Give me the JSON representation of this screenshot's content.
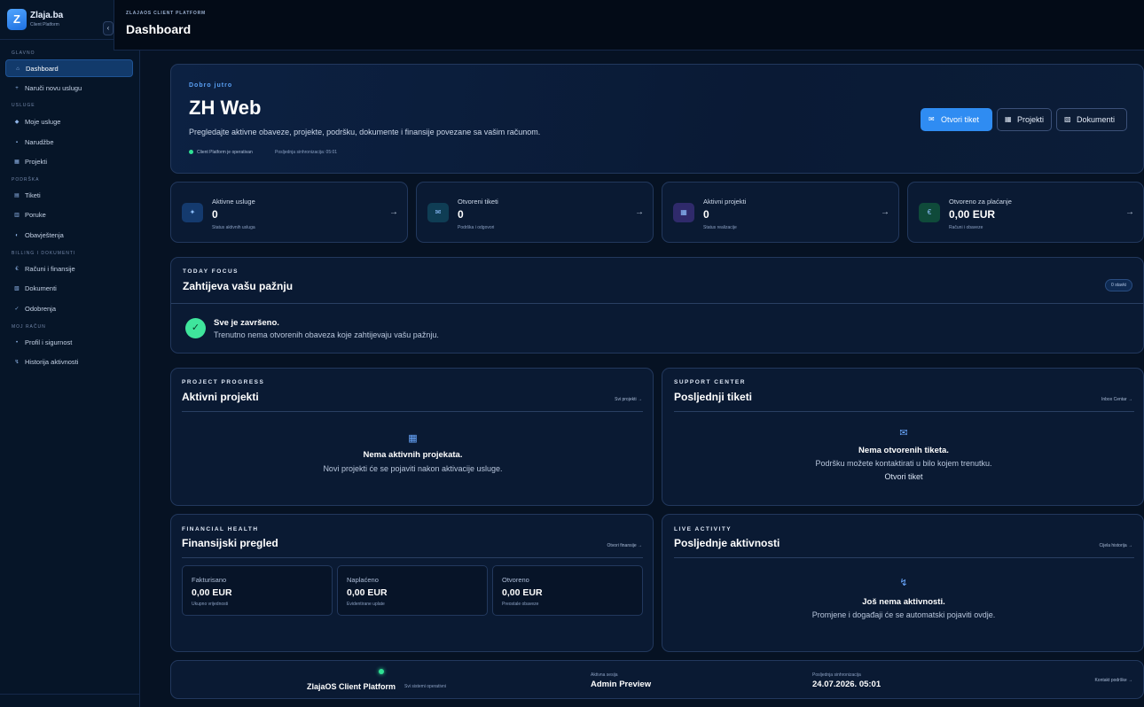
{
  "sidebar": {
    "brand_name": "Zlaja.ba",
    "brand_sub": "Client Platform",
    "logo_letter": "Z",
    "collapse_icon": "‹",
    "sections": [
      {
        "label": "Glavno"
      },
      {
        "label": "Usluge"
      },
      {
        "label": "Podrška"
      },
      {
        "label": "Billing i dokumenti"
      },
      {
        "label": "Moj račun"
      }
    ],
    "items": [
      {
        "label": "Dashboard",
        "icon": "home-icon",
        "glyph": "⌂"
      },
      {
        "label": "Naruči novu uslugu",
        "icon": "plus-icon",
        "glyph": "+"
      },
      {
        "label": "Moje usluge",
        "icon": "box-icon",
        "glyph": "◆"
      },
      {
        "label": "Narudžbe",
        "icon": "cart-icon",
        "glyph": "▪"
      },
      {
        "label": "Projekti",
        "icon": "grid-icon",
        "glyph": "▦"
      },
      {
        "label": "Tiketi",
        "icon": "ticket-icon",
        "glyph": "▤"
      },
      {
        "label": "Poruke",
        "icon": "message-icon",
        "glyph": "▥"
      },
      {
        "label": "Obavještenja",
        "icon": "bell-icon",
        "glyph": "◐"
      },
      {
        "label": "Računi i finansije",
        "icon": "euro-icon",
        "glyph": "€"
      },
      {
        "label": "Dokumenti",
        "icon": "document-icon",
        "glyph": "▧"
      },
      {
        "label": "Odobrenja",
        "icon": "check-icon",
        "glyph": "✓"
      },
      {
        "label": "Profil i sigurnost",
        "icon": "user-icon",
        "glyph": "•"
      },
      {
        "label": "Historija aktivnosti",
        "icon": "history-icon",
        "glyph": "↯"
      }
    ]
  },
  "topbar": {
    "eyebrow": "ZLAJAOS CLIENT PLATFORM",
    "title": "Dashboard"
  },
  "hero": {
    "eyebrow": "Dobro jutro",
    "title": "ZH Web",
    "description": "Pregledajte aktivne obaveze, projekte, podršku, dokumente i finansije povezane sa vašim računom.",
    "status": "Client Platform je operativan",
    "sync": "Posljednja sinhronizacija: 05:01",
    "buttons": [
      {
        "label": "Otvori tiket",
        "glyph": "✉"
      },
      {
        "label": "Projekti",
        "glyph": "▦"
      },
      {
        "label": "Dokumenti",
        "glyph": "▧"
      }
    ]
  },
  "stats": [
    {
      "label": "Aktivne usluge",
      "value": "0",
      "sub": "Status aktivnih usluga",
      "glyph": "✦",
      "color": "#143a6e"
    },
    {
      "label": "Otvoreni tiketi",
      "value": "0",
      "sub": "Podrška i odgovori",
      "glyph": "✉",
      "color": "#0f3d54"
    },
    {
      "label": "Aktivni projekti",
      "value": "0",
      "sub": "Status realizacije",
      "glyph": "▦",
      "color": "#2f2a6b"
    },
    {
      "label": "Otvoreno za plaćanje",
      "value": "0,00 EUR",
      "sub": "Računi i obaveze",
      "glyph": "€",
      "color": "#0f4a3a"
    }
  ],
  "stat_arrow": "→",
  "focus": {
    "eyebrow": "TODAY FOCUS",
    "title": "Zahtijeva vašu pažnju",
    "badge": "0 stavki",
    "done_title": "Sve je završeno.",
    "done_text": "Trenutno nema otvorenih obaveza koje zahtijevaju vašu pažnju.",
    "check_glyph": "✓"
  },
  "projects": {
    "eyebrow": "PROJECT PROGRESS",
    "title": "Aktivni projekti",
    "link": "Svi projekti →",
    "empty_title": "Nema aktivnih projekata.",
    "empty_text": "Novi projekti će se pojaviti nakon aktivacije usluge.",
    "glyph": "▦"
  },
  "tickets": {
    "eyebrow": "SUPPORT CENTER",
    "title": "Posljednji tiketi",
    "link": "Inbox Centar →",
    "empty_title": "Nema otvorenih tiketa.",
    "empty_text": "Podršku možete kontaktirati u bilo kojem trenutku.",
    "action": "Otvori tiket",
    "glyph": "✉"
  },
  "finance": {
    "eyebrow": "FINANCIAL HEALTH",
    "title": "Finansijski pregled",
    "link": "Otvori finansije →",
    "boxes": [
      {
        "label": "Fakturisano",
        "value": "0,00 EUR",
        "sub": "Ukupno vrijednosti"
      },
      {
        "label": "Naplaćeno",
        "value": "0,00 EUR",
        "sub": "Evidentirane uplate"
      },
      {
        "label": "Otvoreno",
        "value": "0,00 EUR",
        "sub": "Preostale obaveze"
      }
    ]
  },
  "activity": {
    "eyebrow": "LIVE ACTIVITY",
    "title": "Posljednje aktivnosti",
    "link": "Cijela historija →",
    "empty_title": "Još nema aktivnosti.",
    "empty_text": "Promjene i događaji će se automatski pojaviti ovdje.",
    "glyph": "↯"
  },
  "footer": {
    "platform": "ZlajaOS Client Platform",
    "platform_status": "Svi sistemi operativni",
    "session_label": "Aktivna sesija",
    "session_value": "Admin Preview",
    "sync_label": "Posljednja sinhronizacija",
    "sync_value": "24.07.2026. 05:01",
    "link": "Kontakt podrške →"
  }
}
